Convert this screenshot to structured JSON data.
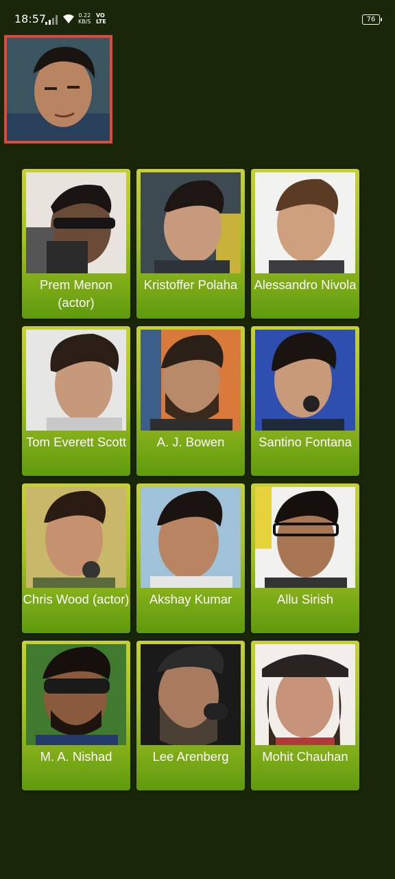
{
  "status_bar": {
    "time": "18:57",
    "net_speed_value": "0.22",
    "net_speed_unit": "KB/S",
    "volte_line1": "VO",
    "volte_line2": "LTE",
    "battery": "76",
    "icons": [
      "signal-icon",
      "wifi-icon",
      "battery-icon"
    ]
  },
  "target": {
    "description_icon": "face-photo",
    "border_color": "#e0483c"
  },
  "cards": [
    {
      "name": "Prem Menon (actor)"
    },
    {
      "name": "Kristoffer Polaha"
    },
    {
      "name": "Alessandro Nivola"
    },
    {
      "name": "Tom Everett Scott"
    },
    {
      "name": "A. J. Bowen"
    },
    {
      "name": "Santino Fontana"
    },
    {
      "name": "Chris Wood (actor)"
    },
    {
      "name": "Akshay Kumar"
    },
    {
      "name": "Allu Sirish"
    },
    {
      "name": "M. A. Nishad"
    },
    {
      "name": "Lee Arenberg"
    },
    {
      "name": "Mohit Chauhan"
    }
  ],
  "colors": {
    "background": "#1a2608",
    "card_top": "#c5d136",
    "card_bottom": "#5f9a0e"
  }
}
